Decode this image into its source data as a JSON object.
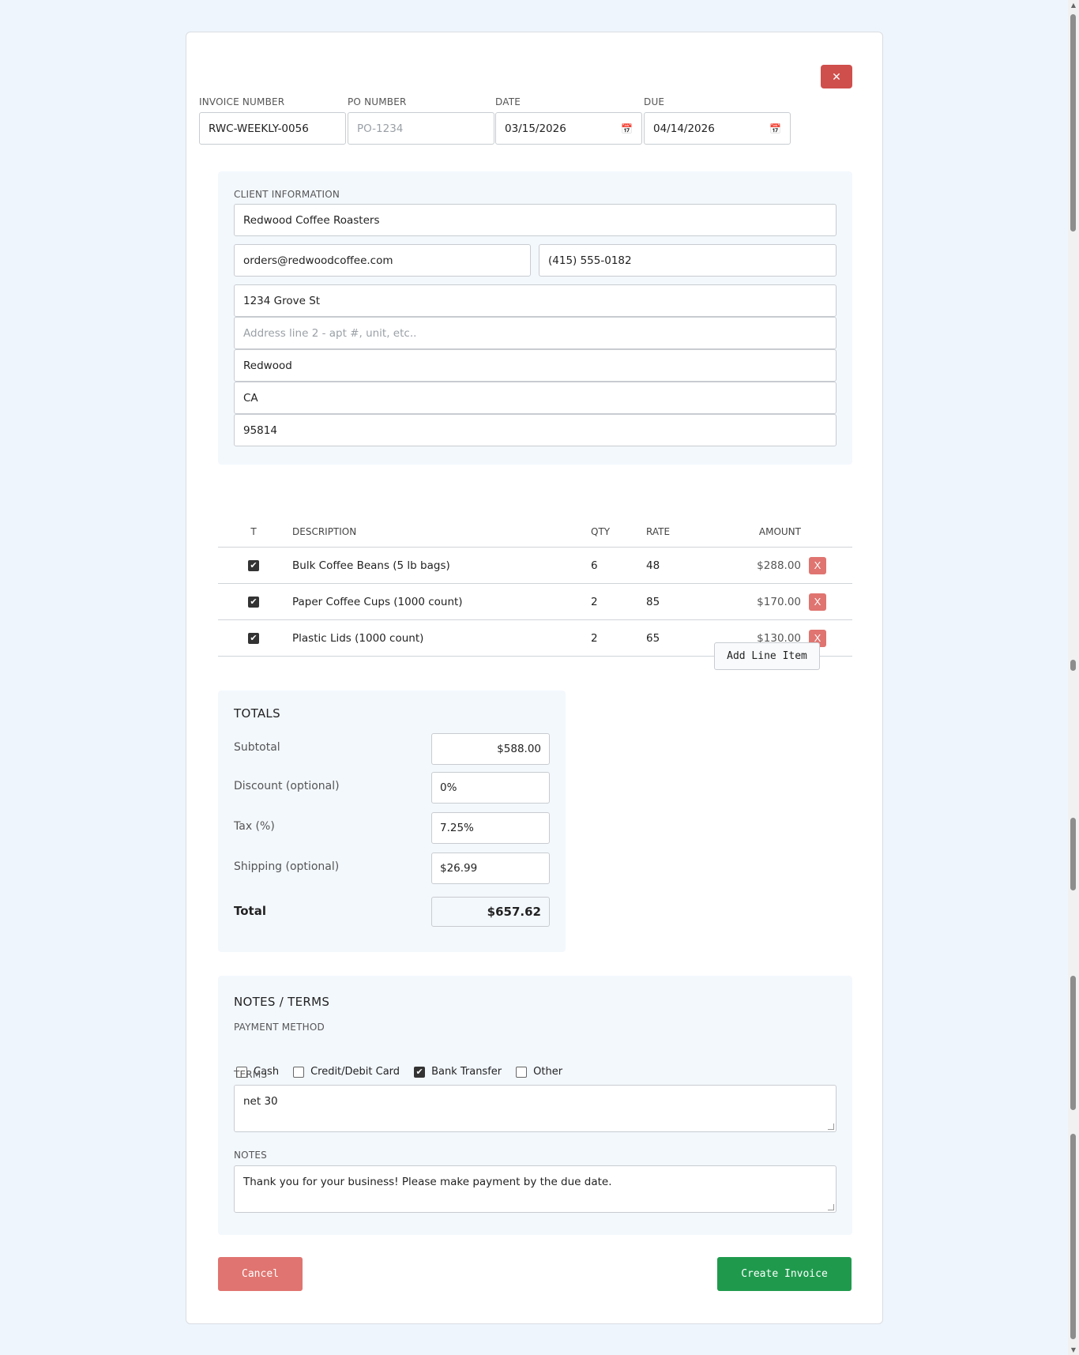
{
  "header": {
    "close_label": "✕",
    "fields": [
      {
        "label": "INVOICE NUMBER",
        "value": "RWC-WEEKLY-0056",
        "placeholder": ""
      },
      {
        "label": "PO NUMBER",
        "value": "",
        "placeholder": "PO-1234"
      },
      {
        "label": "DATE",
        "value": "03/15/2026",
        "placeholder": ""
      },
      {
        "label": "DUE",
        "value": "04/14/2026",
        "placeholder": ""
      }
    ]
  },
  "client": {
    "section_label": "CLIENT INFORMATION",
    "name": "Redwood Coffee Roasters",
    "email": "orders@redwoodcoffee.com",
    "phone": "(415) 555-0182",
    "address1": "1234 Grove St",
    "address2_placeholder": "Address line 2 - apt #, unit, etc..",
    "city": "Redwood",
    "state": "CA",
    "zip": "95814"
  },
  "items": {
    "headers": [
      "T",
      "DESCRIPTION",
      "QTY",
      "RATE",
      "AMOUNT"
    ],
    "rows": [
      {
        "taxable": true,
        "description": "Bulk Coffee Beans (5 lb bags)",
        "qty": "6",
        "rate": "48",
        "amount": "$288.00",
        "remove": "X"
      },
      {
        "taxable": true,
        "description": "Paper Coffee Cups (1000 count)",
        "qty": "2",
        "rate": "85",
        "amount": "$170.00",
        "remove": "X"
      },
      {
        "taxable": true,
        "description": "Plastic Lids (1000 count)",
        "qty": "2",
        "rate": "65",
        "amount": "$130.00",
        "remove": "X"
      }
    ],
    "add_label": "Add Line Item"
  },
  "totals": {
    "title": "TOTALS",
    "subtotal_label": "Subtotal",
    "subtotal": "$588.00",
    "discount_label": "Discount (optional)",
    "discount": "0%",
    "tax_label": "Tax (%)",
    "tax": "7.25%",
    "shipping_label": "Shipping (optional)",
    "shipping": "$26.99",
    "total_label": "Total",
    "total": "$657.62"
  },
  "notes": {
    "title": "NOTES / TERMS",
    "payment_label": "PAYMENT METHOD",
    "payment_methods": [
      {
        "label": "Cash",
        "checked": false
      },
      {
        "label": "Credit/Debit Card",
        "checked": false
      },
      {
        "label": "Bank Transfer",
        "checked": true
      },
      {
        "label": "Other",
        "checked": false
      }
    ],
    "terms_label": "TERMS",
    "terms": "net 30",
    "notes_label": "NOTES",
    "notes": "Thank you for your business! Please make payment by the due date."
  },
  "actions": {
    "cancel": "Cancel",
    "create": "Create Invoice"
  },
  "icons": {
    "calendar": "calendar-icon",
    "checkmark": "✔"
  },
  "colors": {
    "page_bg": "#eef5fc",
    "close": "#cf4f4c",
    "remove": "#e07470",
    "create": "#1f9a4d"
  }
}
